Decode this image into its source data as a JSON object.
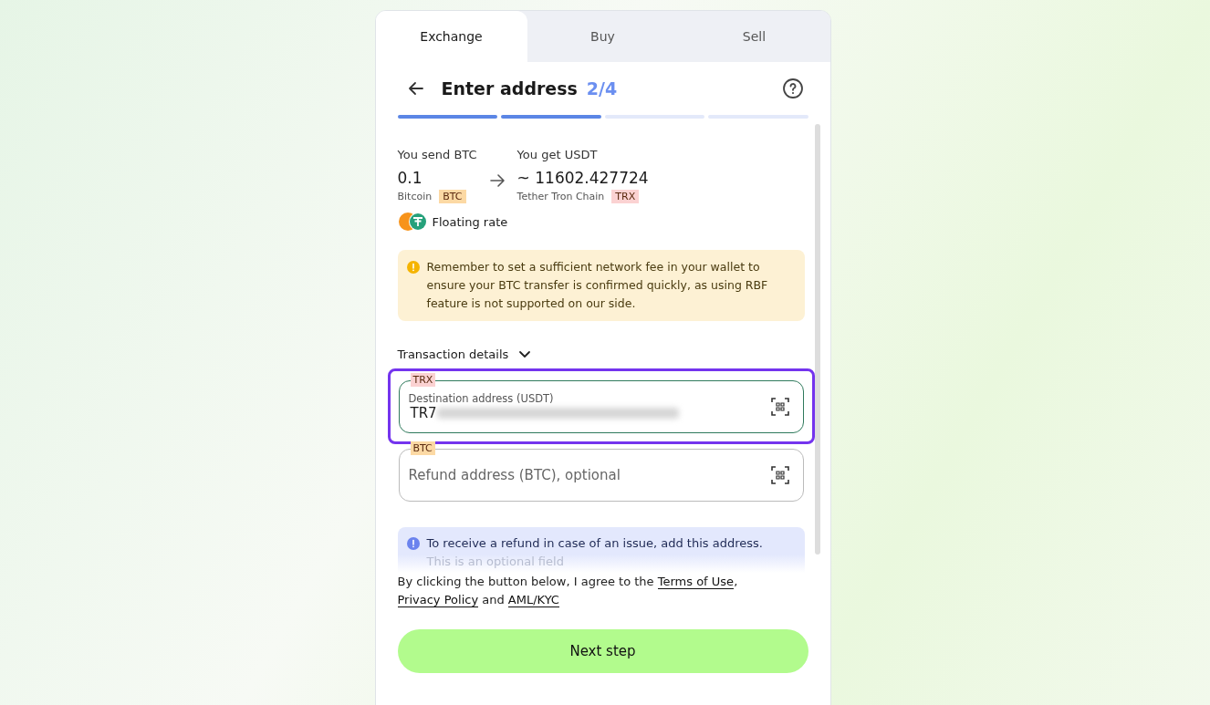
{
  "tabs": [
    {
      "label": "Exchange",
      "selected": true
    },
    {
      "label": "Buy",
      "selected": false
    },
    {
      "label": "Sell",
      "selected": false
    }
  ],
  "header": {
    "title": "Enter address",
    "step": "2/4"
  },
  "steps": [
    {
      "done": true
    },
    {
      "done": true
    },
    {
      "done": false
    },
    {
      "done": false
    }
  ],
  "send": {
    "label": "You send BTC",
    "amount": "0.1",
    "name": "Bitcoin",
    "ticker": {
      "text": "BTC",
      "color": "#fcd9a4"
    }
  },
  "get": {
    "label": "You get USDT",
    "amount": "~ 11602.427724",
    "name": "Tether Tron Chain",
    "ticker": {
      "text": "TRX",
      "color": "#fbd2d2"
    }
  },
  "rate": "Floating rate",
  "warning": "Remember to set a sufficient network fee in your wallet to ensure your BTC transfer is confirmed quickly, as using RBF feature is not supported on our side.",
  "details_toggle": {
    "label": "Transaction details",
    "expanded": false
  },
  "fields": [
    {
      "tag": {
        "text": "TRX",
        "color": "#fbd2d2"
      },
      "label": "Destination address (USDT)",
      "value": "TR7",
      "blurred": true,
      "focused": true,
      "highlighted": true
    },
    {
      "tag": {
        "text": "BTC",
        "color": "#fcd9a4"
      },
      "placeholder": "Refund address (BTC), optional",
      "focused": false,
      "highlighted": false
    }
  ],
  "info": {
    "line1": "To receive a refund in case of an issue, add this address.",
    "line2": "This is an optional field"
  },
  "agreement": [
    {
      "kind": "text",
      "text": "By clicking the button below, I agree to the "
    },
    {
      "kind": "link",
      "text": "Terms of Use"
    },
    {
      "kind": "text",
      "text": ", "
    },
    {
      "kind": "link",
      "text": "Privacy Policy"
    },
    {
      "kind": "text",
      "text": " and "
    },
    {
      "kind": "link",
      "text": "AML/KYC"
    }
  ],
  "next_button": "Next step"
}
